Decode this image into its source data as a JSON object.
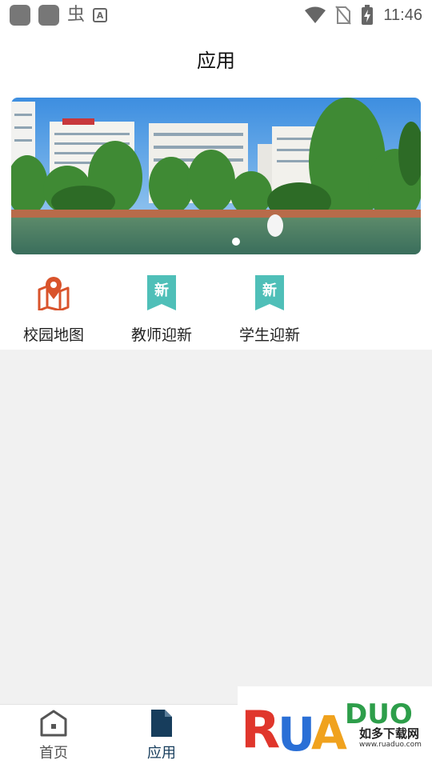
{
  "status_bar": {
    "time": "11:46",
    "left_glyph": "虫",
    "a_label": "A",
    "icons": [
      "app-square-icon",
      "app-square-icon",
      "bug-icon",
      "text-a-icon",
      "wifi-icon",
      "no-sim-icon",
      "battery-charging-icon"
    ]
  },
  "header": {
    "title": "应用"
  },
  "banner": {
    "slides": 1,
    "active_slide": 1,
    "image": "campus-photo"
  },
  "apps": [
    {
      "label": "校园地图",
      "icon": "map-pin-icon"
    },
    {
      "label": "教师迎新",
      "icon": "new-badge-icon",
      "badge": "新"
    },
    {
      "label": "学生迎新",
      "icon": "new-badge-icon",
      "badge": "新"
    }
  ],
  "nav": [
    {
      "label": "首页",
      "icon": "home-icon",
      "active": false
    },
    {
      "label": "应用",
      "icon": "document-icon",
      "active": true
    }
  ],
  "watermark": {
    "logo": "RUANDUO",
    "subtitle": "如多下载网",
    "url": "www.ruaduo.com"
  },
  "colors": {
    "accent": "#173d5c",
    "map_icon": "#d9532b",
    "badge": "#4fbfb8",
    "content_bg": "#f1f1f1"
  }
}
